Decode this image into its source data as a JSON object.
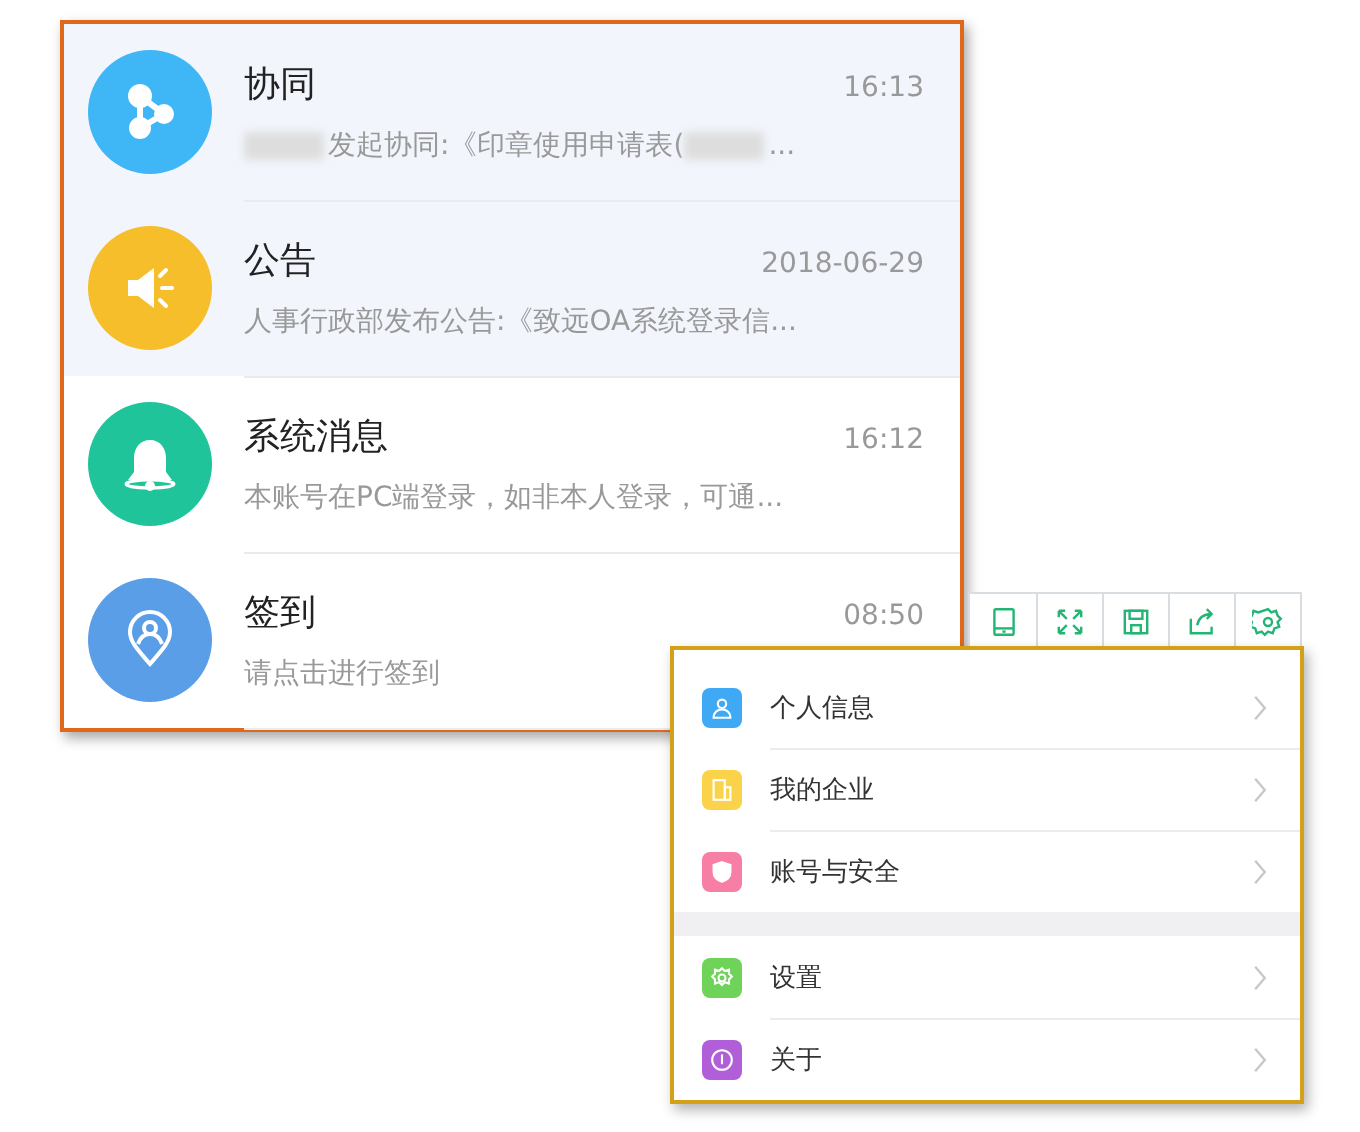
{
  "messages": [
    {
      "kind": "collab",
      "title": "协同",
      "time": "16:13",
      "color": "#3fb6f5",
      "highlighted": true,
      "preview_parts": [
        {
          "kind": "redacted"
        },
        {
          "kind": "text",
          "text": "发起协同:《印章使用申请表("
        },
        {
          "kind": "redacted"
        },
        {
          "kind": "text",
          "text": "..."
        }
      ]
    },
    {
      "kind": "notice",
      "title": "公告",
      "time": "2018-06-29",
      "color": "#f5be2a",
      "highlighted": true,
      "preview_parts": [
        {
          "kind": "text",
          "text": "人事行政部发布公告:《致远OA系统登录信..."
        }
      ]
    },
    {
      "kind": "system",
      "title": "系统消息",
      "time": "16:12",
      "color": "#1fc49a",
      "highlighted": false,
      "preview_parts": [
        {
          "kind": "text",
          "text": "本账号在PC端登录，如非本人登录，可通..."
        }
      ]
    },
    {
      "kind": "checkin",
      "title": "签到",
      "time": "08:50",
      "color": "#5a9ee8",
      "highlighted": false,
      "preview_parts": [
        {
          "kind": "text",
          "text": "请点击进行签到"
        }
      ]
    }
  ],
  "toolbar": [
    {
      "kind": "tablet"
    },
    {
      "kind": "expand"
    },
    {
      "kind": "save"
    },
    {
      "kind": "share"
    },
    {
      "kind": "settings"
    }
  ],
  "menu_groups": [
    [
      {
        "kind": "person",
        "label": "个人信息",
        "color": "#3fa9f5"
      },
      {
        "kind": "company",
        "label": "我的企业",
        "color": "#fbd34a"
      },
      {
        "kind": "shield",
        "label": "账号与安全",
        "color": "#f77fa6"
      }
    ],
    [
      {
        "kind": "gear",
        "label": "设置",
        "color": "#6fd35a"
      },
      {
        "kind": "info",
        "label": "关于",
        "color": "#b05fd8"
      }
    ]
  ]
}
